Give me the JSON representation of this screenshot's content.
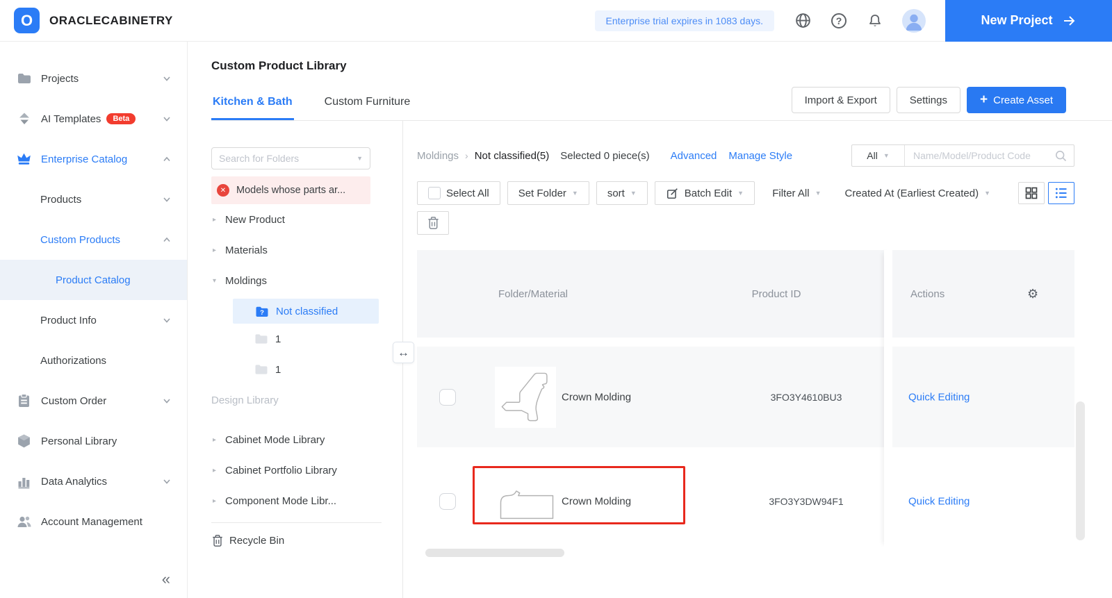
{
  "colors": {
    "primary": "#2b7cf6",
    "annotation": "#e8291d",
    "beta_badge": "#f23c2e",
    "alert_bg": "#fdeded"
  },
  "icons": {
    "logo_letter": "O",
    "help_glyph": "?",
    "collapse_glyph": "«",
    "resize_glyph": "↔",
    "gear_glyph": "⚙",
    "alert_x_glyph": "✕",
    "caret_collapsed": "▸",
    "caret_expanded": "▾",
    "dropdown_arrow": "▼",
    "breadcrumb_sep": "›",
    "plus_glyph": "+",
    "folder_question_glyph": "?"
  },
  "header": {
    "brand": "ORACLECABINETRY",
    "trial_notice": "Enterprise trial expires in 1083 days.",
    "new_project_label": "New Project"
  },
  "sidebar": {
    "items": [
      {
        "label": "Projects"
      },
      {
        "label": "AI Templates",
        "badge": "Beta"
      },
      {
        "label": "Enterprise Catalog"
      },
      {
        "label": "Products"
      },
      {
        "label": "Custom Products"
      },
      {
        "label": "Product Catalog"
      },
      {
        "label": "Product Info"
      },
      {
        "label": "Authorizations"
      },
      {
        "label": "Custom Order"
      },
      {
        "label": "Personal Library"
      },
      {
        "label": "Data Analytics"
      },
      {
        "label": "Account Management"
      }
    ]
  },
  "page": {
    "title": "Custom Product Library",
    "tabs": [
      {
        "label": "Kitchen & Bath",
        "active": true
      },
      {
        "label": "Custom Furniture",
        "active": false
      }
    ],
    "import_export_label": "Import & Export",
    "settings_label": "Settings",
    "create_asset_label": "Create Asset"
  },
  "folder_panel": {
    "search_placeholder": "Search for Folders",
    "alert_label": "Models whose parts ar...",
    "tree": [
      {
        "label": "New Product"
      },
      {
        "label": "Materials"
      },
      {
        "label": "Moldings"
      },
      {
        "label": "Not classified"
      },
      {
        "label": "1"
      },
      {
        "label": "1"
      }
    ],
    "design_library_label": "Design Library",
    "design_tree": [
      {
        "label": "Cabinet Mode Library"
      },
      {
        "label": "Cabinet Portfolio Library"
      },
      {
        "label": "Component Mode Libr..."
      }
    ],
    "recycle_bin_label": "Recycle Bin"
  },
  "toolbar": {
    "breadcrumb_parent": "Moldings",
    "breadcrumb_current": "Not classified(5)",
    "selected_text": "Selected 0 piece(s)",
    "advanced_label": "Advanced",
    "manage_style_label": "Manage Style",
    "scope_dropdown_value": "All",
    "search_placeholder": "Name/Model/Product Code",
    "select_all_label": "Select All",
    "set_folder_label": "Set Folder",
    "sort_label": "sort",
    "batch_edit_label": "Batch Edit",
    "filter_label": "Filter All",
    "order_label": "Created At (Earliest Created)"
  },
  "table": {
    "columns": {
      "folder_material": "Folder/Material",
      "product_id": "Product ID",
      "actions": "Actions"
    },
    "rows": [
      {
        "name": "Crown Molding",
        "product_id": "3FO3Y4610BU3",
        "action_label": "Quick Editing",
        "highlighted": false
      },
      {
        "name": "Crown Molding",
        "product_id": "3FO3Y3DW94F1",
        "action_label": "Quick Editing",
        "highlighted": true
      }
    ]
  }
}
